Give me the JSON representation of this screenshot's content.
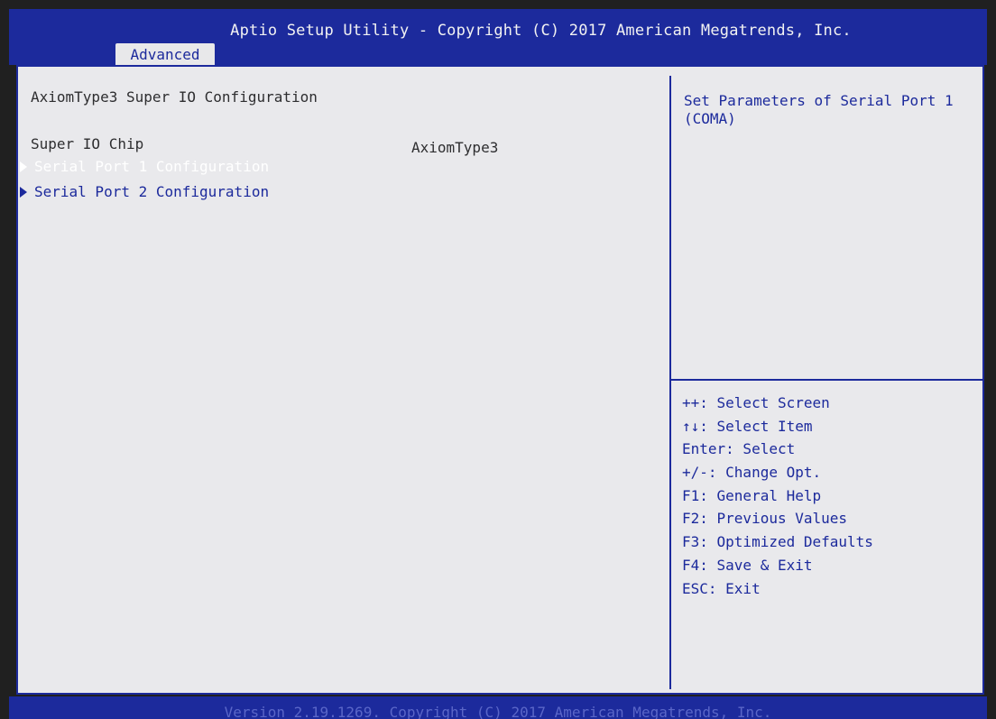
{
  "header": {
    "title": "Aptio Setup Utility - Copyright (C) 2017 American Megatrends, Inc.",
    "active_tab": "Advanced"
  },
  "main": {
    "section_title": "AxiomType3 Super IO Configuration",
    "chip_label": "Super IO Chip",
    "chip_value": "AxiomType3",
    "menu_items": [
      {
        "label": "Serial Port 1 Configuration",
        "selected": true
      },
      {
        "label": "Serial Port 2 Configuration",
        "selected": false
      }
    ]
  },
  "help": {
    "description": "Set Parameters of Serial Port 1 (COMA)"
  },
  "keys": [
    "++: Select Screen",
    "↑↓: Select Item",
    "Enter: Select",
    "+/-: Change Opt.",
    "F1: General Help",
    "F2: Previous Values",
    "F3: Optimized Defaults",
    "F4: Save & Exit",
    "ESC: Exit"
  ],
  "footer": {
    "text": "Version 2.19.1269. Copyright (C) 2017 American Megatrends, Inc."
  },
  "colors": {
    "bios_blue": "#1c2a9c",
    "panel_bg": "#e9e9ec",
    "selected_text": "#ffffff"
  }
}
